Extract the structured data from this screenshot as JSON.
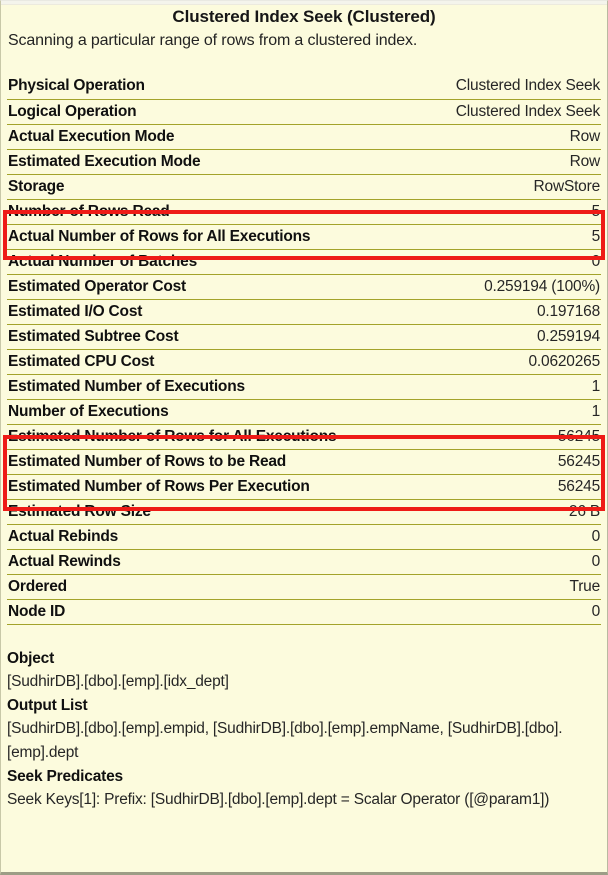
{
  "tooltip": {
    "title": "Clustered Index Seek (Clustered)",
    "description": "Scanning a particular range of rows from a clustered index.",
    "properties": [
      {
        "key": "Physical Operation",
        "value": "Clustered Index Seek"
      },
      {
        "key": "Logical Operation",
        "value": "Clustered Index Seek"
      },
      {
        "key": "Actual Execution Mode",
        "value": "Row"
      },
      {
        "key": "Estimated Execution Mode",
        "value": "Row"
      },
      {
        "key": "Storage",
        "value": "RowStore"
      },
      {
        "key": "Number of Rows Read",
        "value": "5"
      },
      {
        "key": "Actual Number of Rows for All Executions",
        "value": "5"
      },
      {
        "key": "Actual Number of Batches",
        "value": "0"
      },
      {
        "key": "Estimated Operator Cost",
        "value": "0.259194 (100%)"
      },
      {
        "key": "Estimated I/O Cost",
        "value": "0.197168"
      },
      {
        "key": "Estimated Subtree Cost",
        "value": "0.259194"
      },
      {
        "key": "Estimated CPU Cost",
        "value": "0.0620265"
      },
      {
        "key": "Estimated Number of Executions",
        "value": "1"
      },
      {
        "key": "Number of Executions",
        "value": "1"
      },
      {
        "key": "Estimated Number of Rows for All Executions",
        "value": "56245"
      },
      {
        "key": "Estimated Number of Rows to be Read",
        "value": "56245"
      },
      {
        "key": "Estimated Number of Rows Per Execution",
        "value": "56245"
      },
      {
        "key": "Estimated Row Size",
        "value": "26 B"
      },
      {
        "key": "Actual Rebinds",
        "value": "0"
      },
      {
        "key": "Actual Rewinds",
        "value": "0"
      },
      {
        "key": "Ordered",
        "value": "True"
      },
      {
        "key": "Node ID",
        "value": "0"
      }
    ],
    "sections": [
      {
        "heading": "Object",
        "text": "[SudhirDB].[dbo].[emp].[idx_dept]"
      },
      {
        "heading": "Output List",
        "text": "[SudhirDB].[dbo].[emp].empid, [SudhirDB].[dbo].[emp].empName, [SudhirDB].[dbo].[emp].dept"
      },
      {
        "heading": "Seek Predicates",
        "text": "Seek Keys[1]: Prefix: [SudhirDB].[dbo].[emp].dept = Scalar Operator ([@param1])"
      }
    ],
    "highlights": [
      {
        "name": "highlight-actual-rows",
        "color": "#ee1b17",
        "rows": [
          "Number of Rows Read",
          "Actual Number of Rows for All Executions"
        ]
      },
      {
        "name": "highlight-estimated-rows",
        "color": "#ee1b17",
        "rows": [
          "Estimated Number of Rows for All Executions",
          "Estimated Number of Rows to be Read",
          "Estimated Number of Rows Per Execution"
        ]
      }
    ]
  }
}
